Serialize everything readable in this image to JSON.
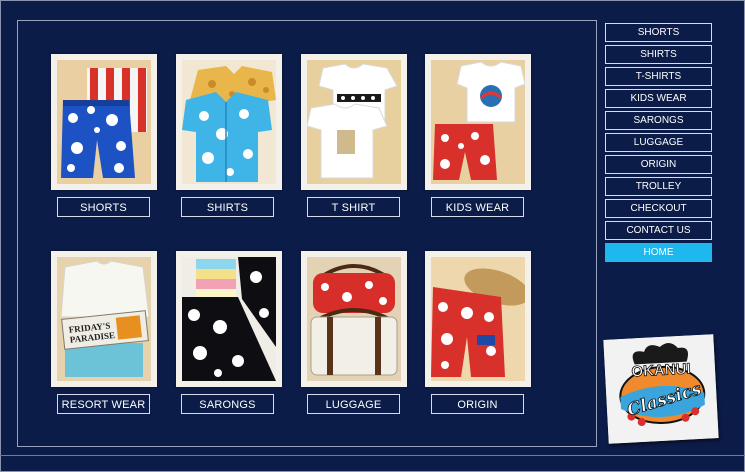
{
  "categories": [
    {
      "label": "SHORTS",
      "icon": "shorts-photo"
    },
    {
      "label": "SHIRTS",
      "icon": "shirts-photo"
    },
    {
      "label": "T SHIRT",
      "icon": "tshirt-photo"
    },
    {
      "label": "KIDS WEAR",
      "icon": "kidswear-photo"
    },
    {
      "label": "RESORT WEAR",
      "icon": "resortwear-photo"
    },
    {
      "label": "SARONGS",
      "icon": "sarongs-photo"
    },
    {
      "label": "LUGGAGE",
      "icon": "luggage-photo"
    },
    {
      "label": "ORIGIN",
      "icon": "origin-photo"
    }
  ],
  "nav": [
    {
      "label": "SHORTS"
    },
    {
      "label": "SHIRTS"
    },
    {
      "label": "T-SHIRTS"
    },
    {
      "label": "KIDS WEAR"
    },
    {
      "label": "SARONGS"
    },
    {
      "label": "LUGGAGE"
    },
    {
      "label": "ORIGIN"
    },
    {
      "label": "TROLLEY"
    },
    {
      "label": "CHECKOUT"
    },
    {
      "label": "CONTACT US"
    },
    {
      "label": "HOME",
      "active": true
    }
  ],
  "product_labels": {
    "resort_tag_line1": "FRIDAY'S",
    "resort_tag_line2": "PARADISE"
  },
  "logo": {
    "line1": "OKANUI",
    "line2": "Classics"
  },
  "colors": {
    "background": "#0c1c48",
    "active_nav": "#1fb8ee",
    "button_border": "#d8dcea"
  }
}
